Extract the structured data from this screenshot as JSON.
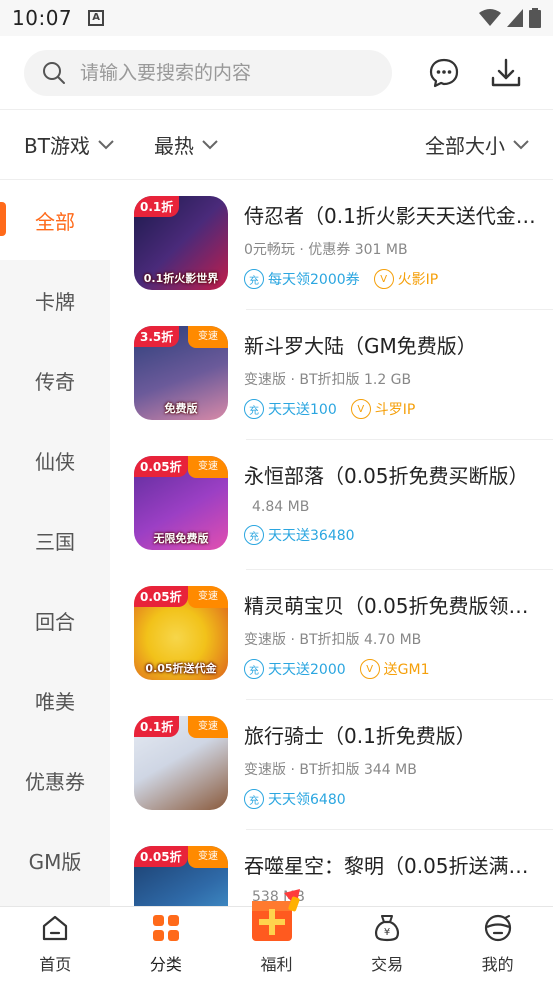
{
  "status_bar": {
    "time": "10:07",
    "notif": "A"
  },
  "search": {
    "placeholder": "请输入要搜索的内容"
  },
  "filters": [
    {
      "label": "BT游戏"
    },
    {
      "label": "最热"
    },
    {
      "label": "全部大小"
    }
  ],
  "sidebar": {
    "items": [
      {
        "label": "全部",
        "active": true
      },
      {
        "label": "卡牌"
      },
      {
        "label": "传奇"
      },
      {
        "label": "仙侠"
      },
      {
        "label": "三国"
      },
      {
        "label": "回合"
      },
      {
        "label": "唯美"
      },
      {
        "label": "优惠券"
      },
      {
        "label": "GM版"
      }
    ]
  },
  "games": [
    {
      "title": "侍忍者（0.1折火影天天送代金…",
      "meta": "0元畅玩 · 优惠券  301 MB",
      "icon_tag": "0.1折",
      "icon_caption": "0.1折火影世界",
      "tags": [
        {
          "type": "充",
          "text": "每天领2000券",
          "color": "blue"
        },
        {
          "type": "V",
          "text": "火影IP",
          "color": "gold"
        }
      ],
      "colors": [
        "#1b1a4a",
        "#c21d4a"
      ]
    },
    {
      "title": "新斗罗大陆（GM免费版）",
      "meta": "变速版 · BT折扣版  1.2 GB",
      "icon_tag": "3.5折",
      "icon_corner": "变速",
      "icon_caption": "免费版",
      "tags": [
        {
          "type": "充",
          "text": "天天送100",
          "color": "blue"
        },
        {
          "type": "V",
          "text": "斗罗IP",
          "color": "gold"
        }
      ],
      "colors": [
        "#2c3f7a",
        "#d88aa8"
      ]
    },
    {
      "title": "永恒部落（0.05折免费买断版）",
      "meta": "4.84 MB",
      "icon_tag": "0.05折",
      "icon_corner": "变速",
      "icon_caption": "无限免费版",
      "tags": [
        {
          "type": "充",
          "text": "天天送36480",
          "color": "blue"
        }
      ],
      "colors": [
        "#5b2c9a",
        "#e24fb0"
      ]
    },
    {
      "title": "精灵萌宝贝（0.05折免费版领…",
      "meta": "变速版 · BT折扣版  4.70 MB",
      "icon_tag": "0.05折",
      "icon_corner": "变速",
      "icon_caption": "0.05折送代金",
      "tags": [
        {
          "type": "充",
          "text": "天天送2000",
          "color": "blue"
        },
        {
          "type": "V",
          "text": "送GM1",
          "color": "gold"
        }
      ],
      "colors": [
        "#f2c21a",
        "#d9531e"
      ]
    },
    {
      "title": "旅行骑士（0.1折免费版）",
      "meta": "变速版 · BT折扣版  344 MB",
      "icon_tag": "0.1折",
      "icon_corner": "变速",
      "icon_caption": "",
      "tags": [
        {
          "type": "充",
          "text": "天天领6480",
          "color": "blue"
        }
      ],
      "colors": [
        "#cfd6e4",
        "#8a5a3c"
      ]
    },
    {
      "title": "吞噬星空：黎明（0.05折送满…",
      "meta": "538 MB",
      "icon_tag": "0.05折",
      "icon_corner": "变速",
      "icon_caption": "",
      "tags": [],
      "colors": [
        "#1a3b6a",
        "#4aa3d8"
      ]
    }
  ],
  "bottom_nav": [
    {
      "label": "首页",
      "icon": "home-icon"
    },
    {
      "label": "分类",
      "icon": "category-icon",
      "active": true
    },
    {
      "label": "福利",
      "icon": "welfare-icon"
    },
    {
      "label": "交易",
      "icon": "trade-icon"
    },
    {
      "label": "我的",
      "icon": "profile-icon"
    }
  ],
  "accent": "#ff6a1a"
}
